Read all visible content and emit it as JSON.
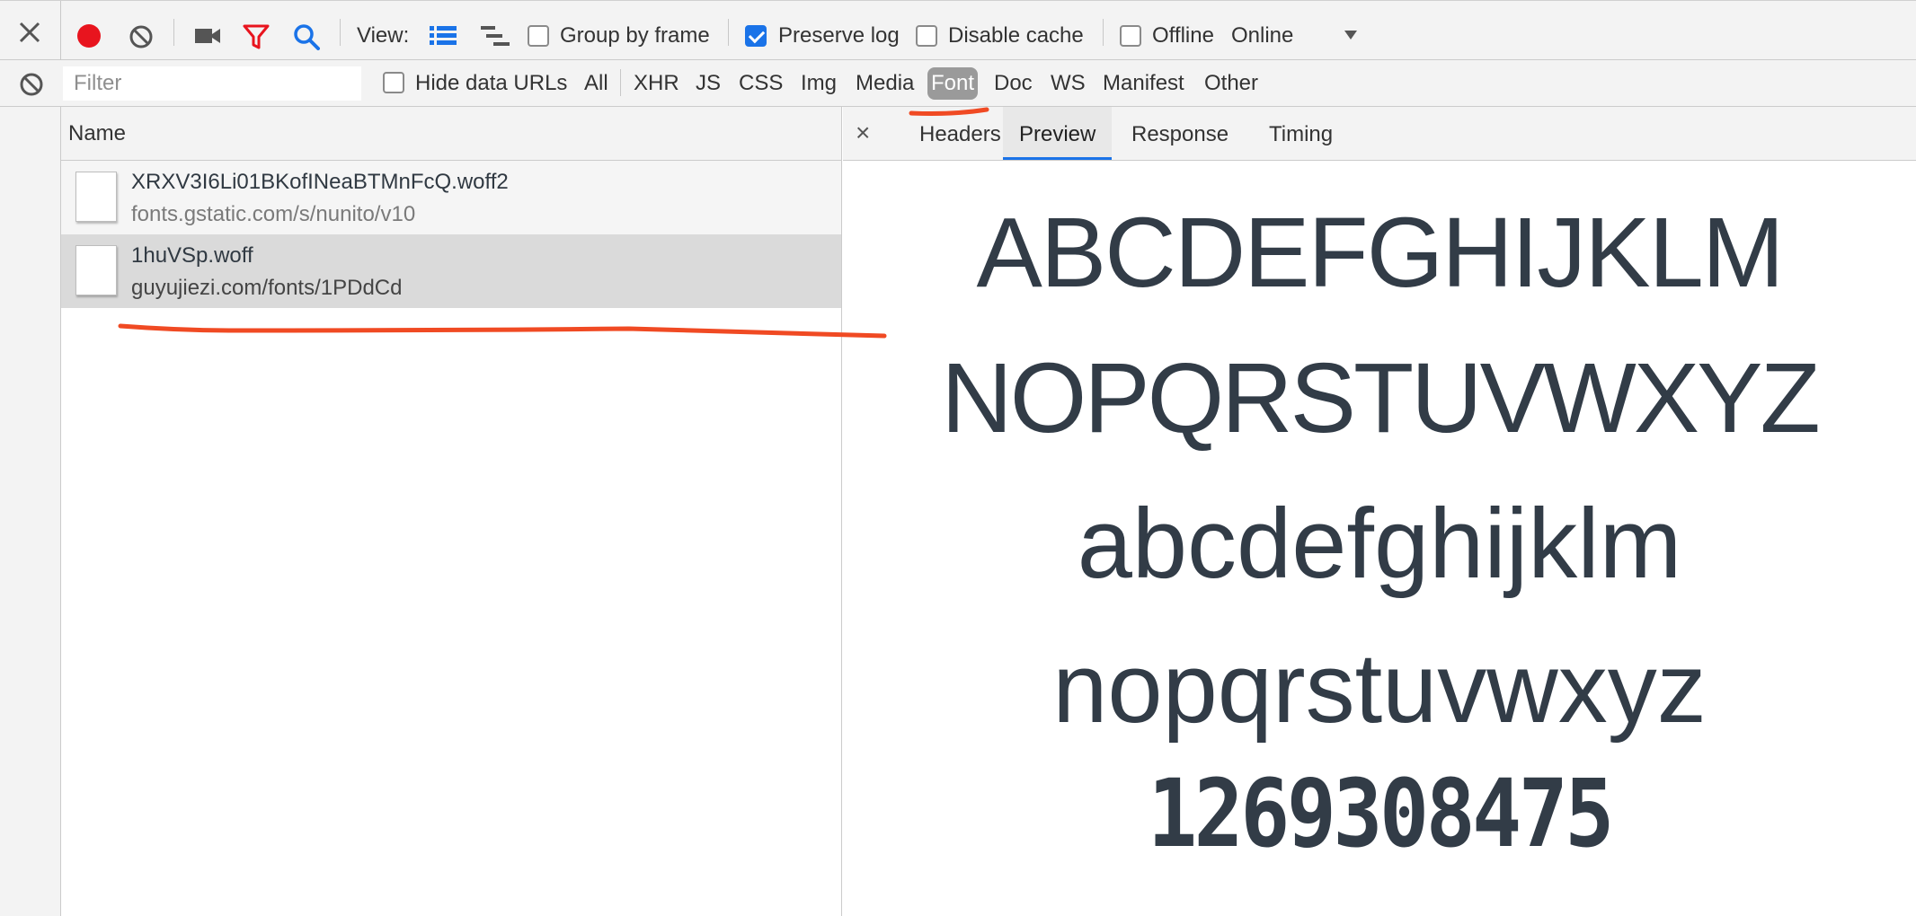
{
  "toolbar": {
    "view_label": "View:",
    "group_by_frame_label": "Group by frame",
    "group_by_frame_checked": false,
    "preserve_log_label": "Preserve log",
    "preserve_log_checked": true,
    "disable_cache_label": "Disable cache",
    "disable_cache_checked": false,
    "offline_label": "Offline",
    "offline_checked": false,
    "throttling_value": "Online",
    "record_color": "#e8141e",
    "filter_icon_color": "#e8141e",
    "accent_color": "#1a73e8"
  },
  "filterbar": {
    "filter_placeholder": "Filter",
    "hide_data_urls_label": "Hide data URLs",
    "hide_data_urls_checked": false,
    "types": [
      "All",
      "XHR",
      "JS",
      "CSS",
      "Img",
      "Media",
      "Font",
      "Doc",
      "WS",
      "Manifest",
      "Other"
    ],
    "active_type": "Font"
  },
  "list": {
    "header_name": "Name",
    "rows": [
      {
        "name": "XRXV3I6Li01BKofINeaBTMnFcQ.woff2",
        "path": "fonts.gstatic.com/s/nunito/v10",
        "selected": false
      },
      {
        "name": "1huVSp.woff",
        "path": "guyujiezi.com/fonts/1PDdCd",
        "selected": true
      }
    ]
  },
  "detail": {
    "close_glyph": "×",
    "tabs": [
      "Headers",
      "Preview",
      "Response",
      "Timing"
    ],
    "active_tab": "Preview",
    "preview": {
      "line1": "ABCDEFGHIJKLM",
      "line2": "NOPQRSTUVWXYZ",
      "line3": "abcdefghijklm",
      "line4": "nopqrstuvwxyz",
      "line5": "1269308475"
    }
  },
  "annotation_color": "#f04a23"
}
